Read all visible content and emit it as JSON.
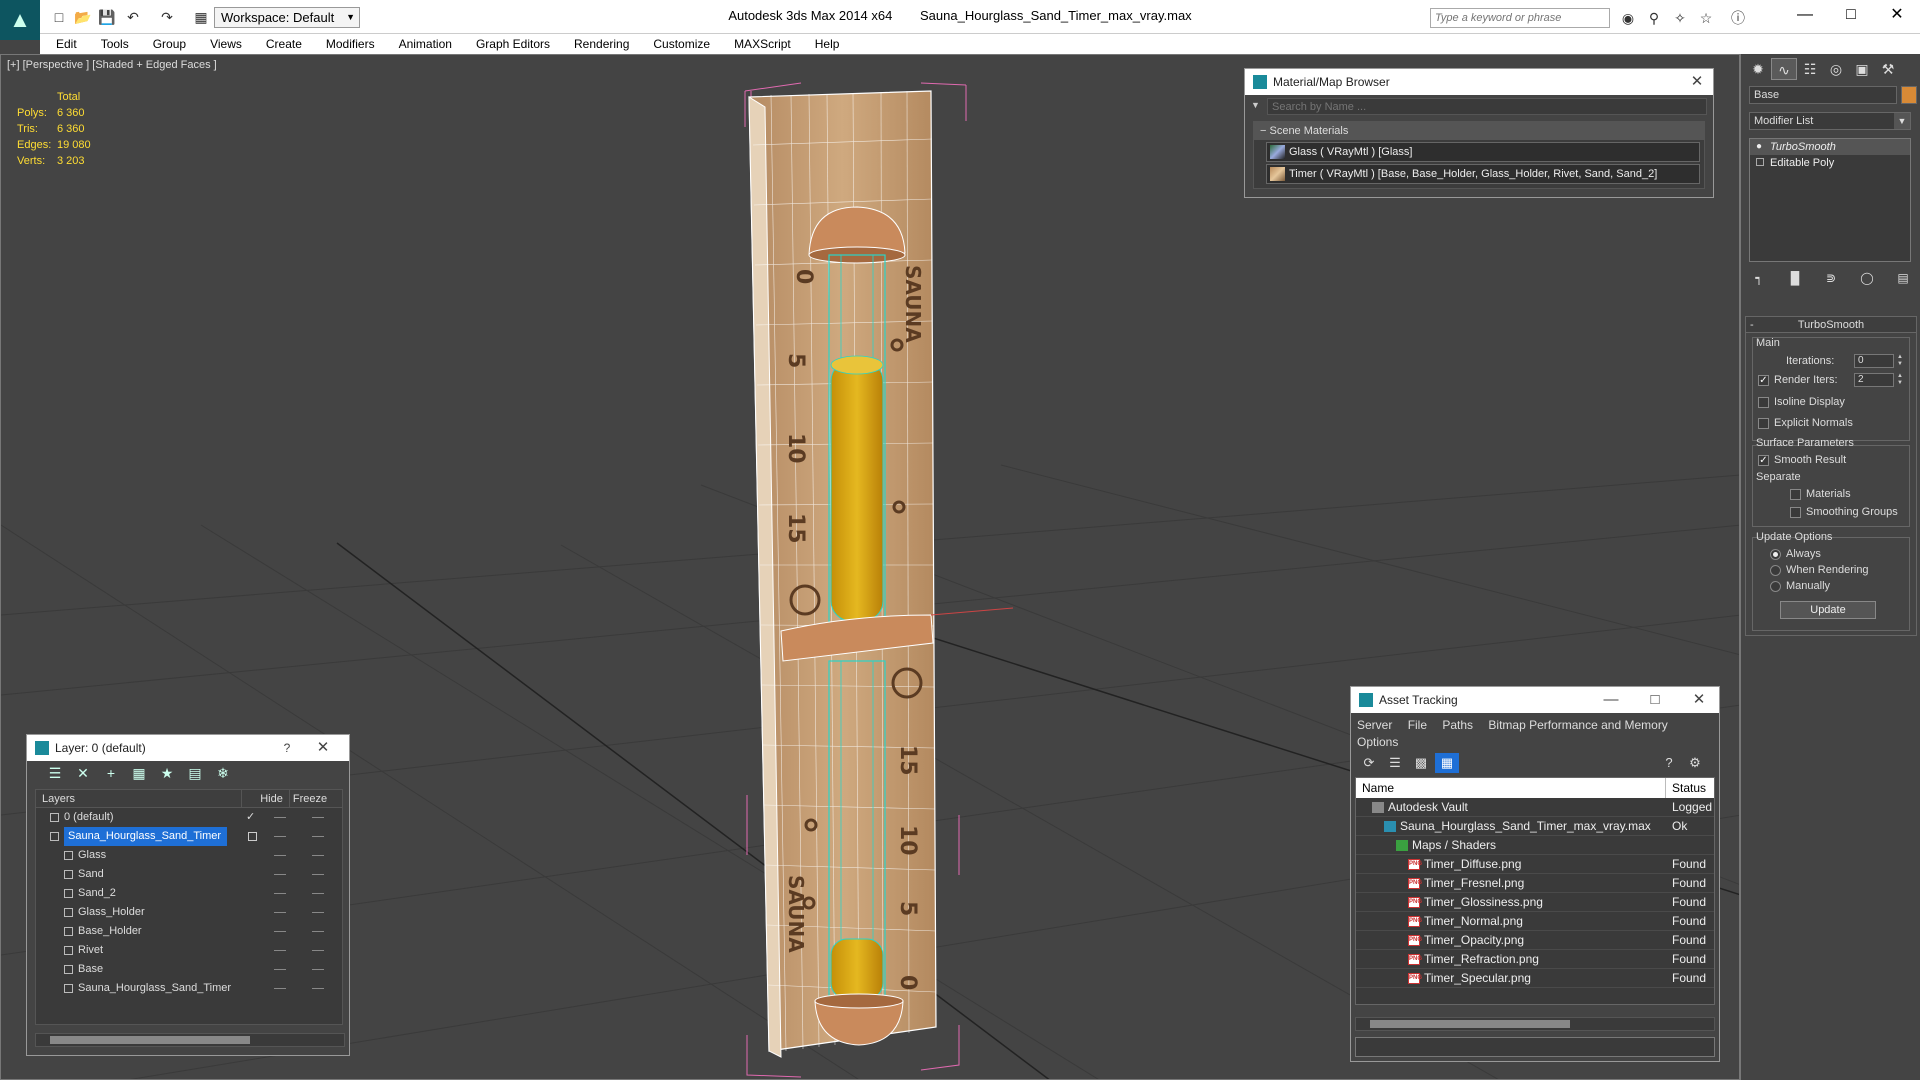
{
  "title": {
    "app": "Autodesk 3ds Max  2014 x64",
    "file": "Sauna_Hourglass_Sand_Timer_max_vray.max"
  },
  "workspace": {
    "label": "Workspace: Default"
  },
  "search": {
    "placeholder": "Type a keyword or phrase"
  },
  "menu": [
    "Edit",
    "Tools",
    "Group",
    "Views",
    "Create",
    "Modifiers",
    "Animation",
    "Graph Editors",
    "Rendering",
    "Customize",
    "MAXScript",
    "Help"
  ],
  "viewport": {
    "label": "[+] [Perspective ] [Shaded + Edged Faces ]",
    "stats": {
      "total_label": "Total",
      "rows": [
        {
          "k": "Polys:",
          "v": "6 360"
        },
        {
          "k": "Tris:",
          "v": "6 360"
        },
        {
          "k": "Edges:",
          "v": "19 080"
        },
        {
          "k": "Verts:",
          "v": "3 203"
        }
      ]
    },
    "numbers_left": [
      "0",
      "5",
      "10",
      "15"
    ],
    "numbers_right": [
      "15",
      "10",
      "5",
      "0"
    ],
    "word_top": "SAUNA",
    "word_bottom": "SAUNA"
  },
  "material_browser": {
    "title": "Material/Map Browser",
    "search_placeholder": "Search by Name ...",
    "section": "Scene Materials",
    "items": [
      "Glass  ( VRayMtl )  [Glass]",
      "Timer  ( VRayMtl )  [Base, Base_Holder, Glass_Holder, Rivet, Sand, Sand_2]"
    ]
  },
  "layer_panel": {
    "title": "Layer: 0 (default)",
    "help": "?",
    "col_layers": "Layers",
    "col_hide": "Hide",
    "col_freeze": "Freeze",
    "rows": [
      {
        "name": "0 (default)",
        "level": 0,
        "selected": false
      },
      {
        "name": "Sauna_Hourglass_Sand_Timer",
        "level": 0,
        "selected": true
      },
      {
        "name": "Glass",
        "level": 1,
        "selected": false
      },
      {
        "name": "Sand",
        "level": 1,
        "selected": false
      },
      {
        "name": "Sand_2",
        "level": 1,
        "selected": false
      },
      {
        "name": "Glass_Holder",
        "level": 1,
        "selected": false
      },
      {
        "name": "Base_Holder",
        "level": 1,
        "selected": false
      },
      {
        "name": "Rivet",
        "level": 1,
        "selected": false
      },
      {
        "name": "Base",
        "level": 1,
        "selected": false
      },
      {
        "name": "Sauna_Hourglass_Sand_Timer",
        "level": 1,
        "selected": false
      }
    ]
  },
  "asset_tracking": {
    "title": "Asset Tracking",
    "menu": [
      "Server",
      "File",
      "Paths",
      "Bitmap Performance and Memory",
      "Options"
    ],
    "col_name": "Name",
    "col_status": "Status",
    "rows": [
      {
        "name": "Autodesk Vault",
        "status": "Logged",
        "level": 0,
        "icon": "vault-icon"
      },
      {
        "name": "Sauna_Hourglass_Sand_Timer_max_vray.max",
        "status": "Ok",
        "level": 1,
        "icon": "max-file-icon"
      },
      {
        "name": "Maps / Shaders",
        "status": "",
        "level": 2,
        "icon": "maps-icon"
      },
      {
        "name": "Timer_Diffuse.png",
        "status": "Found",
        "level": 3,
        "icon": "png-icon"
      },
      {
        "name": "Timer_Fresnel.png",
        "status": "Found",
        "level": 3,
        "icon": "png-icon"
      },
      {
        "name": "Timer_Glossiness.png",
        "status": "Found",
        "level": 3,
        "icon": "png-icon"
      },
      {
        "name": "Timer_Normal.png",
        "status": "Found",
        "level": 3,
        "icon": "png-icon"
      },
      {
        "name": "Timer_Opacity.png",
        "status": "Found",
        "level": 3,
        "icon": "png-icon"
      },
      {
        "name": "Timer_Refraction.png",
        "status": "Found",
        "level": 3,
        "icon": "png-icon"
      },
      {
        "name": "Timer_Specular.png",
        "status": "Found",
        "level": 3,
        "icon": "png-icon"
      }
    ],
    "png_glyph": "PNG"
  },
  "command_panel": {
    "object_name": "Base",
    "object_color": "#d88a36",
    "modifier_list": "Modifier List",
    "stack": [
      "TurboSmooth",
      "Editable Poly"
    ],
    "rollout_title": "TurboSmooth",
    "main_label": "Main",
    "iterations_label": "Iterations:",
    "iterations_value": "0",
    "render_iters_label": "Render Iters:",
    "render_iters_value": "2",
    "render_iters_checked": true,
    "isoline_label": "Isoline Display",
    "explicit_normals_label": "Explicit Normals",
    "surface_params_label": "Surface Parameters",
    "smooth_result_label": "Smooth Result",
    "smooth_result_checked": true,
    "separate_label": "Separate",
    "materials_label": "Materials",
    "smoothing_groups_label": "Smoothing Groups",
    "update_options_label": "Update Options",
    "always_label": "Always",
    "when_rendering_label": "When Rendering",
    "manually_label": "Manually",
    "update_button": "Update"
  },
  "colors": {
    "accent_select": "#1e6fd6",
    "stats_yellow": "#ffdd33",
    "wood": "#c9a27a",
    "wire_cyan": "#2ad4c8",
    "sand": "#d9a710"
  }
}
